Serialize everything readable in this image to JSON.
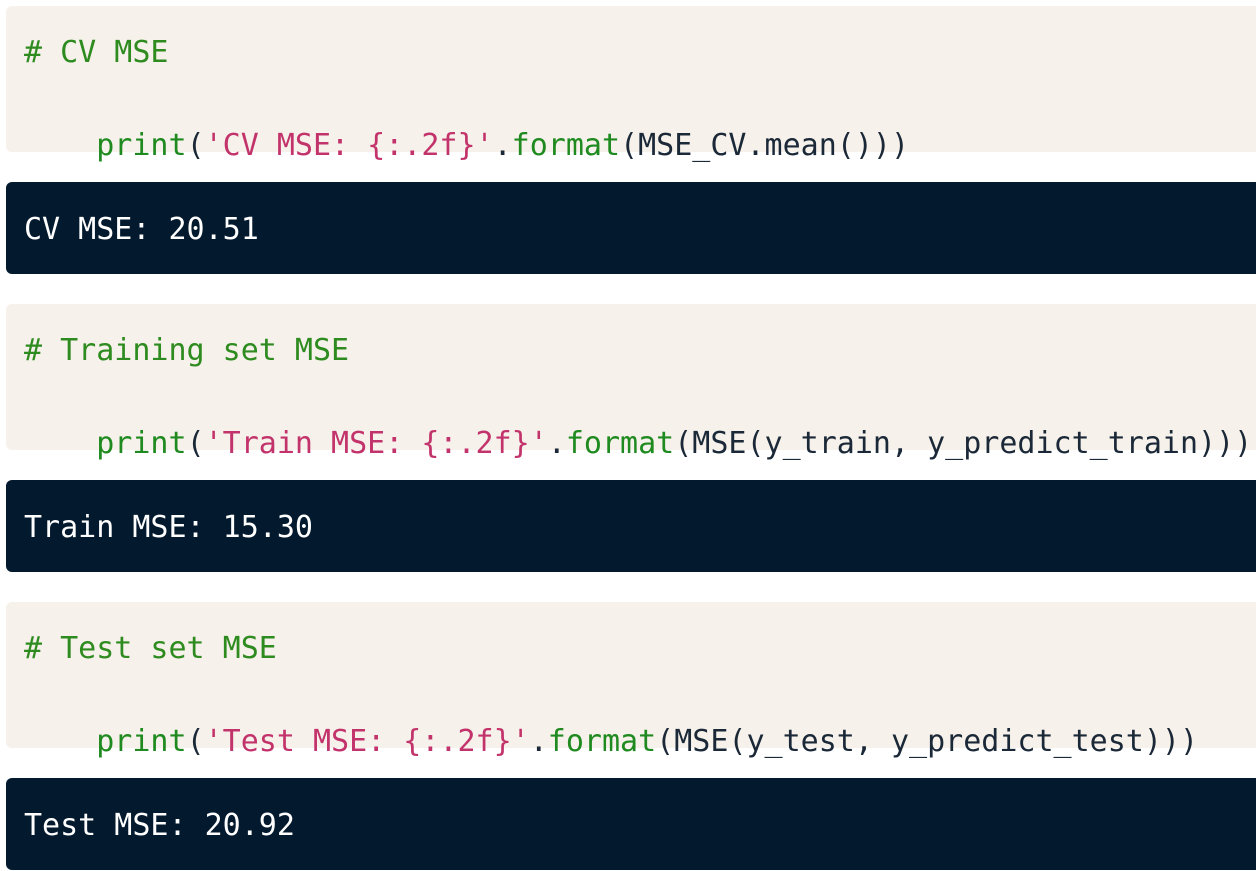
{
  "colors": {
    "code_bg": "#f6f1ea",
    "output_bg": "#03192e",
    "comment": "#2e8b1f",
    "builtin": "#1f8a1f",
    "string": "#c3336b",
    "plain": "#1b2838",
    "output_text": "#ffffff"
  },
  "cells": [
    {
      "code": {
        "comment": "# CV MSE",
        "tokens": [
          {
            "kind": "builtin",
            "text": "print"
          },
          {
            "kind": "plain",
            "text": "("
          },
          {
            "kind": "string",
            "text": "'CV MSE: {:.2f}'"
          },
          {
            "kind": "plain",
            "text": "."
          },
          {
            "kind": "builtin",
            "text": "format"
          },
          {
            "kind": "plain",
            "text": "(MSE_CV.mean()))"
          }
        ]
      },
      "output": "CV MSE: 20.51"
    },
    {
      "code": {
        "comment": "# Training set MSE",
        "tokens": [
          {
            "kind": "builtin",
            "text": "print"
          },
          {
            "kind": "plain",
            "text": "("
          },
          {
            "kind": "string",
            "text": "'Train MSE: {:.2f}'"
          },
          {
            "kind": "plain",
            "text": "."
          },
          {
            "kind": "builtin",
            "text": "format"
          },
          {
            "kind": "plain",
            "text": "(MSE(y_train, y_predict_train)))"
          }
        ]
      },
      "output": "Train MSE: 15.30"
    },
    {
      "code": {
        "comment": "# Test set MSE",
        "tokens": [
          {
            "kind": "builtin",
            "text": "print"
          },
          {
            "kind": "plain",
            "text": "("
          },
          {
            "kind": "string",
            "text": "'Test MSE: {:.2f}'"
          },
          {
            "kind": "plain",
            "text": "."
          },
          {
            "kind": "builtin",
            "text": "format"
          },
          {
            "kind": "plain",
            "text": "(MSE(y_test, y_predict_test)))"
          }
        ]
      },
      "output": "Test MSE: 20.92"
    }
  ]
}
